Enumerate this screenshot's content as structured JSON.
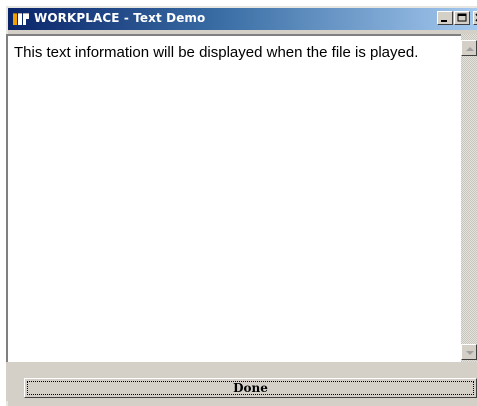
{
  "window": {
    "title": "WORKPLACE - Text Demo",
    "icon": "workplace-app-icon",
    "controls": {
      "minimize_icon": "minimize-icon",
      "maximize_icon": "maximize-icon",
      "close_icon": "close-icon"
    },
    "title_bar_colors": [
      "#0a246a",
      "#a6caf0"
    ]
  },
  "content": {
    "text": "This text information will be displayed when the file is played."
  },
  "scrollbar": {
    "up_icon": "arrow-up-icon",
    "down_icon": "arrow-down-icon"
  },
  "footer": {
    "done_label": "Done"
  }
}
